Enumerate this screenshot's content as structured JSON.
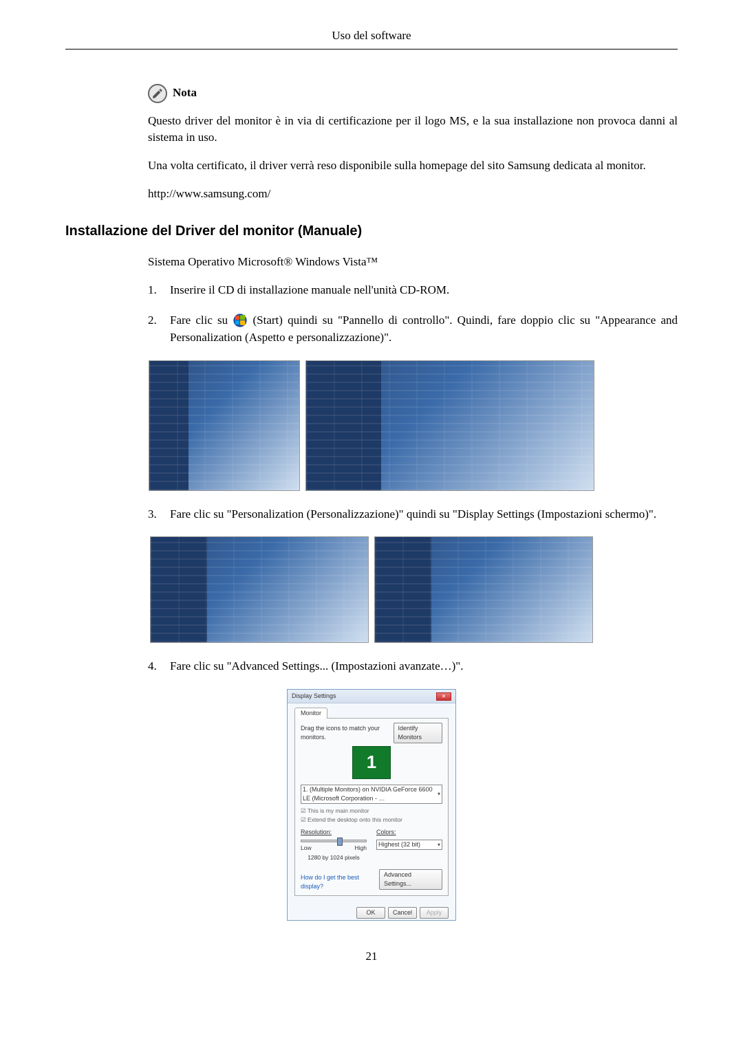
{
  "header": {
    "title": "Uso del software"
  },
  "nota": {
    "label": "Nota",
    "p1": "Questo driver del monitor è in via di certificazione per il logo MS, e la sua installazione non provoca danni al sistema in uso.",
    "p2": "Una volta certificato, il driver verrà reso disponibile sulla homepage del sito Samsung dedicata al monitor.",
    "url": "http://www.samsung.com/"
  },
  "section": {
    "heading": "Installazione del Driver del monitor (Manuale)",
    "intro": "Sistema Operativo Microsoft® Windows Vista™"
  },
  "steps": {
    "s1": {
      "num": "1.",
      "text": "Inserire il CD di installazione manuale nell'unità CD-ROM."
    },
    "s2": {
      "num": "2.",
      "pre": "Fare clic su ",
      "post": "(Start) quindi su \"Pannello di controllo\". Quindi, fare doppio clic su \"Appearance and Personalization (Aspetto e personalizzazione)\"."
    },
    "s3": {
      "num": "3.",
      "text": "Fare clic su \"Personalization (Personalizzazione)\" quindi su \"Display Settings (Impostazioni schermo)\"."
    },
    "s4": {
      "num": "4.",
      "text": "Fare clic su \"Advanced Settings... (Impostazioni avanzate…)\"."
    }
  },
  "display_settings": {
    "window_title": "Display Settings",
    "tab": "Monitor",
    "drag_text": "Drag the icons to match your monitors.",
    "identify": "Identify Monitors",
    "monitor_number": "1",
    "monitor_select": "1. (Multiple Monitors) on NVIDIA GeForce 6600 LE (Microsoft Corporation - …",
    "check1": "This is my main monitor",
    "check2": "Extend the desktop onto this monitor",
    "resolution_label": "Resolution:",
    "low": "Low",
    "high": "High",
    "res_value": "1280 by 1024 pixels",
    "colors_label": "Colors:",
    "colors_value": "Highest (32 bit)",
    "help_link": "How do I get the best display?",
    "advanced": "Advanced Settings...",
    "ok": "OK",
    "cancel": "Cancel",
    "apply": "Apply"
  },
  "page_number": "21"
}
